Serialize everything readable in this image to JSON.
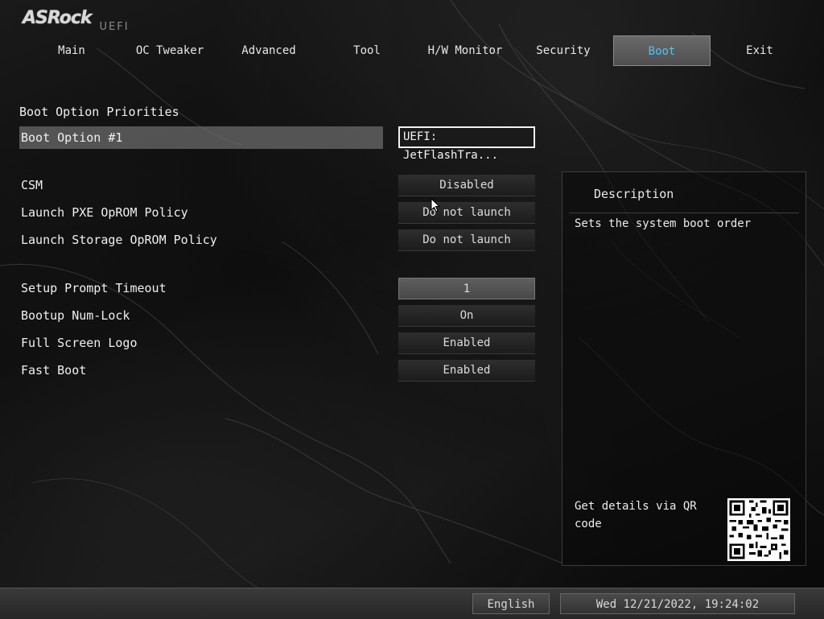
{
  "logo": {
    "brand": "ASRock",
    "suffix": "UEFI"
  },
  "nav": {
    "tabs": [
      {
        "label": "Main"
      },
      {
        "label": "OC Tweaker"
      },
      {
        "label": "Advanced"
      },
      {
        "label": "Tool"
      },
      {
        "label": "H/W Monitor"
      },
      {
        "label": "Security"
      },
      {
        "label": "Boot",
        "active": true
      },
      {
        "label": "Exit"
      }
    ]
  },
  "boot": {
    "section_title": "Boot Option Priorities",
    "boot_option_1": {
      "label": "Boot Option #1",
      "value": "UEFI: JetFlashTra..."
    },
    "csm": {
      "label": "CSM",
      "value": "Disabled"
    },
    "pxe": {
      "label": "Launch PXE OpROM Policy",
      "value": "Do not launch"
    },
    "storage": {
      "label": "Launch Storage OpROM Policy",
      "value": "Do not launch"
    },
    "timeout": {
      "label": "Setup Prompt Timeout",
      "value": "1"
    },
    "numlock": {
      "label": "Bootup Num-Lock",
      "value": "On"
    },
    "logo": {
      "label": "Full Screen Logo",
      "value": "Enabled"
    },
    "fastboot": {
      "label": "Fast Boot",
      "value": "Enabled"
    }
  },
  "description": {
    "title": "Description",
    "text": "Sets the system boot order",
    "qr_text": "Get details via QR code"
  },
  "footer": {
    "language": "English",
    "datetime": "Wed 12/21/2022, 19:24:02"
  },
  "colors": {
    "active_tab_text": "#4fc3f7",
    "highlight_row": "#6e6e6e"
  },
  "icons": {
    "cursor": "mouse-pointer-icon",
    "qr": "qr-code-icon"
  }
}
